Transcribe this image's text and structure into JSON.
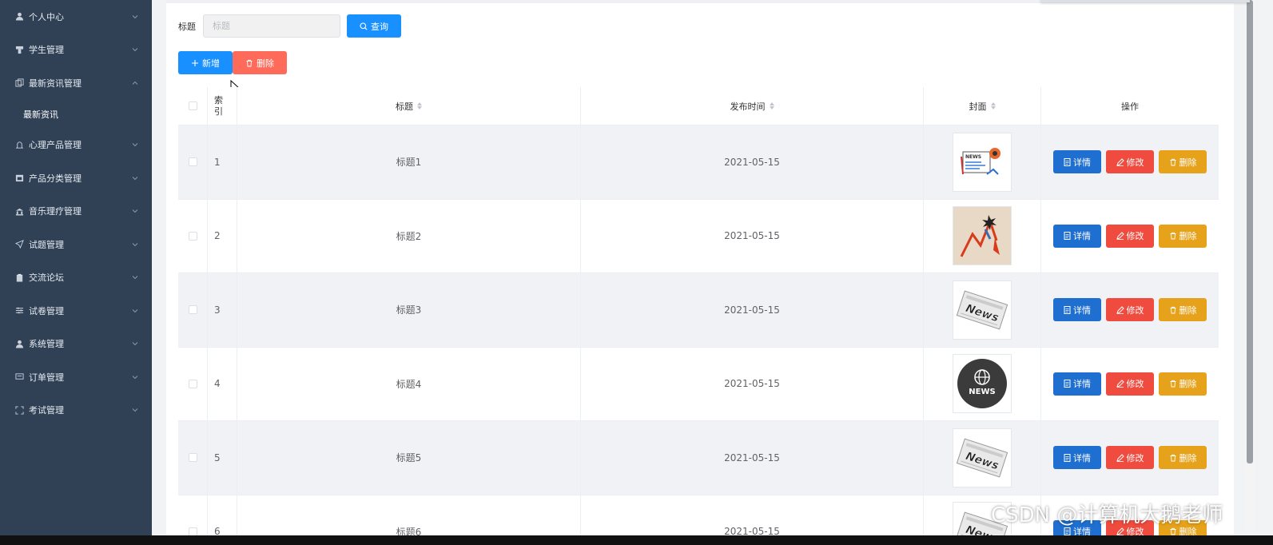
{
  "sidebar": {
    "items": [
      {
        "label": "个人中心",
        "icon": "user-icon"
      },
      {
        "label": "学生管理",
        "icon": "podium-icon"
      },
      {
        "label": "最新资讯管理",
        "icon": "copy-icon",
        "expanded": true,
        "children": [
          {
            "label": "最新资讯"
          }
        ]
      },
      {
        "label": "心理产品管理",
        "icon": "bell-icon"
      },
      {
        "label": "产品分类管理",
        "icon": "calendar-icon"
      },
      {
        "label": "音乐理疗管理",
        "icon": "bank-icon"
      },
      {
        "label": "试题管理",
        "icon": "send-icon"
      },
      {
        "label": "交流论坛",
        "icon": "clipboard-icon"
      },
      {
        "label": "试卷管理",
        "icon": "sliders-icon"
      },
      {
        "label": "系统管理",
        "icon": "user-icon"
      },
      {
        "label": "订单管理",
        "icon": "monitor-icon"
      },
      {
        "label": "考试管理",
        "icon": "fullscreen-icon"
      }
    ]
  },
  "search": {
    "label": "标题",
    "placeholder": "标题",
    "value": "",
    "button_label": "查询"
  },
  "actions": {
    "add_label": "新增",
    "delete_label": "删除"
  },
  "table": {
    "headers": {
      "index": "索引",
      "title": "标题",
      "time": "发布时间",
      "cover": "封面",
      "operations": "操作"
    },
    "op_labels": {
      "detail": "详情",
      "edit": "修改",
      "delete": "删除"
    },
    "rows": [
      {
        "index": "1",
        "title": "标题1",
        "time": "2021-05-15",
        "cover": "news-paper-icon"
      },
      {
        "index": "2",
        "title": "标题2",
        "time": "2021-05-15",
        "cover": "chart-arrow-icon"
      },
      {
        "index": "3",
        "title": "标题3",
        "time": "2021-05-15",
        "cover": "newspaper-icon"
      },
      {
        "index": "4",
        "title": "标题4",
        "time": "2021-05-15",
        "cover": "news-globe-icon"
      },
      {
        "index": "5",
        "title": "标题5",
        "time": "2021-05-15",
        "cover": "newspaper-icon"
      },
      {
        "index": "6",
        "title": "标题6",
        "time": "2021-05-15",
        "cover": "newspaper-icon"
      }
    ]
  },
  "watermark": "CSDN @计算机大鹅老师",
  "colors": {
    "sidebar_bg": "#304156",
    "primary": "#1890ff",
    "danger": "#ef4b3f",
    "warning": "#e6a21a"
  }
}
